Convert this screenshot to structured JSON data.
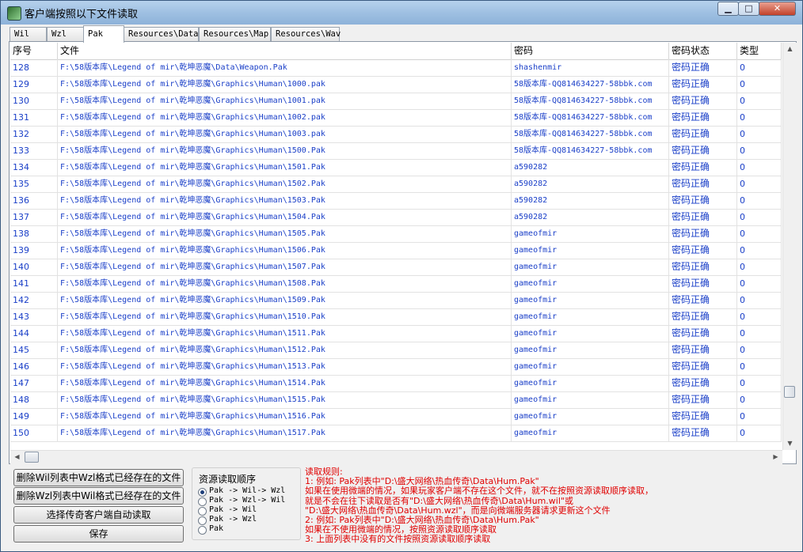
{
  "window": {
    "title": "客户端按照以下文件读取",
    "min_label": "▁",
    "max_label": "□",
    "close_label": "✕"
  },
  "tabs": [
    "Wil",
    "Wzl",
    "Pak",
    "Resources\\Data",
    "Resources\\Map",
    "Resources\\Wav"
  ],
  "table": {
    "headers": [
      "序号",
      "文件",
      "密码",
      "密码状态",
      "类型"
    ],
    "rows": [
      [
        "128",
        "F:\\58版本库\\Legend of mir\\乾坤恶魔\\Data\\Weapon.Pak",
        "shashenmir",
        "密码正确",
        "0"
      ],
      [
        "129",
        "F:\\58版本库\\Legend of mir\\乾坤恶魔\\Graphics\\Human\\1000.pak",
        "58版本库-QQ814634227-58bbk.com",
        "密码正确",
        "0"
      ],
      [
        "130",
        "F:\\58版本库\\Legend of mir\\乾坤恶魔\\Graphics\\Human\\1001.pak",
        "58版本库-QQ814634227-58bbk.com",
        "密码正确",
        "0"
      ],
      [
        "131",
        "F:\\58版本库\\Legend of mir\\乾坤恶魔\\Graphics\\Human\\1002.pak",
        "58版本库-QQ814634227-58bbk.com",
        "密码正确",
        "0"
      ],
      [
        "132",
        "F:\\58版本库\\Legend of mir\\乾坤恶魔\\Graphics\\Human\\1003.pak",
        "58版本库-QQ814634227-58bbk.com",
        "密码正确",
        "0"
      ],
      [
        "133",
        "F:\\58版本库\\Legend of mir\\乾坤恶魔\\Graphics\\Human\\1500.Pak",
        "58版本库-QQ814634227-58bbk.com",
        "密码正确",
        "0"
      ],
      [
        "134",
        "F:\\58版本库\\Legend of mir\\乾坤恶魔\\Graphics\\Human\\1501.Pak",
        "a590282",
        "密码正确",
        "0"
      ],
      [
        "135",
        "F:\\58版本库\\Legend of mir\\乾坤恶魔\\Graphics\\Human\\1502.Pak",
        "a590282",
        "密码正确",
        "0"
      ],
      [
        "136",
        "F:\\58版本库\\Legend of mir\\乾坤恶魔\\Graphics\\Human\\1503.Pak",
        "a590282",
        "密码正确",
        "0"
      ],
      [
        "137",
        "F:\\58版本库\\Legend of mir\\乾坤恶魔\\Graphics\\Human\\1504.Pak",
        "a590282",
        "密码正确",
        "0"
      ],
      [
        "138",
        "F:\\58版本库\\Legend of mir\\乾坤恶魔\\Graphics\\Human\\1505.Pak",
        "gameofmir",
        "密码正确",
        "0"
      ],
      [
        "139",
        "F:\\58版本库\\Legend of mir\\乾坤恶魔\\Graphics\\Human\\1506.Pak",
        "gameofmir",
        "密码正确",
        "0"
      ],
      [
        "140",
        "F:\\58版本库\\Legend of mir\\乾坤恶魔\\Graphics\\Human\\1507.Pak",
        "gameofmir",
        "密码正确",
        "0"
      ],
      [
        "141",
        "F:\\58版本库\\Legend of mir\\乾坤恶魔\\Graphics\\Human\\1508.Pak",
        "gameofmir",
        "密码正确",
        "0"
      ],
      [
        "142",
        "F:\\58版本库\\Legend of mir\\乾坤恶魔\\Graphics\\Human\\1509.Pak",
        "gameofmir",
        "密码正确",
        "0"
      ],
      [
        "143",
        "F:\\58版本库\\Legend of mir\\乾坤恶魔\\Graphics\\Human\\1510.Pak",
        "gameofmir",
        "密码正确",
        "0"
      ],
      [
        "144",
        "F:\\58版本库\\Legend of mir\\乾坤恶魔\\Graphics\\Human\\1511.Pak",
        "gameofmir",
        "密码正确",
        "0"
      ],
      [
        "145",
        "F:\\58版本库\\Legend of mir\\乾坤恶魔\\Graphics\\Human\\1512.Pak",
        "gameofmir",
        "密码正确",
        "0"
      ],
      [
        "146",
        "F:\\58版本库\\Legend of mir\\乾坤恶魔\\Graphics\\Human\\1513.Pak",
        "gameofmir",
        "密码正确",
        "0"
      ],
      [
        "147",
        "F:\\58版本库\\Legend of mir\\乾坤恶魔\\Graphics\\Human\\1514.Pak",
        "gameofmir",
        "密码正确",
        "0"
      ],
      [
        "148",
        "F:\\58版本库\\Legend of mir\\乾坤恶魔\\Graphics\\Human\\1515.Pak",
        "gameofmir",
        "密码正确",
        "0"
      ],
      [
        "149",
        "F:\\58版本库\\Legend of mir\\乾坤恶魔\\Graphics\\Human\\1516.Pak",
        "gameofmir",
        "密码正确",
        "0"
      ],
      [
        "150",
        "F:\\58版本库\\Legend of mir\\乾坤恶魔\\Graphics\\Human\\1517.Pak",
        "gameofmir",
        "密码正确",
        "0"
      ]
    ]
  },
  "buttons": {
    "delete_wil": "删除Wil列表中Wzl格式已经存在的文件",
    "delete_wzl": "删除Wzl列表中Wil格式已经存在的文件",
    "auto_read": "选择传奇客户端自动读取",
    "save": "保存"
  },
  "read_order": {
    "title": "资源读取顺序",
    "options": [
      "Pak -> Wil-> Wzl",
      "Pak -> Wzl-> Wil",
      "Pak -> Wil",
      "Pak -> Wzl",
      "Pak"
    ]
  },
  "rules": [
    "读取规则:",
    "1: 例如: Pak列表中\"D:\\盛大网络\\热血传奇\\Data\\Hum.Pak\"",
    "    如果在使用微端的情况，如果玩家客户端不存在这个文件，就不在按照资源读取顺序读取，",
    "    就是不会在往下读取是否有\"D:\\盛大网络\\热血传奇\\Data\\Hum.wil\"或",
    "    \"D:\\盛大网络\\热血传奇\\Data\\Hum.wzl\"，而是向微端服务器请求更新这个文件",
    "2: 例如: Pak列表中\"D:\\盛大网络\\热血传奇\\Data\\Hum.Pak\"",
    "    如果在不使用微端的情况，按照资源读取顺序读取",
    "3: 上面列表中没有的文件按照资源读取顺序读取"
  ]
}
